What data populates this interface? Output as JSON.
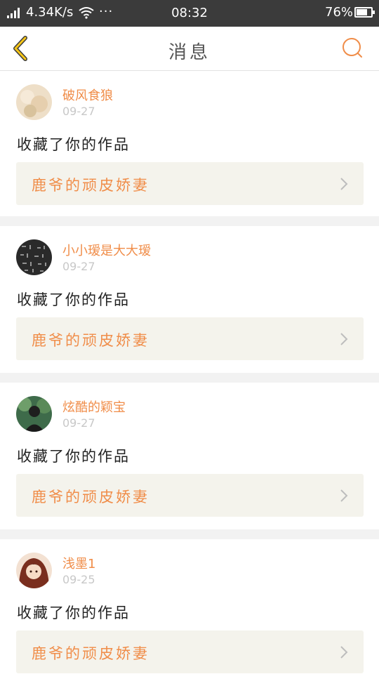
{
  "status_bar": {
    "network_speed": "4.34K/s",
    "more": "···",
    "time": "08:32",
    "battery_percent": "76%",
    "battery_level": 0.76
  },
  "navbar": {
    "title": "消息",
    "back_icon": "chevron-left-icon",
    "search_icon": "search-icon"
  },
  "colors": {
    "accent": "#f08d49",
    "back_arrow": "#f5c518",
    "status_bar_bg": "#3b3b3b",
    "card_work_bg": "#f4f3ec"
  },
  "notifications": [
    {
      "username": "破风食狼",
      "date": "09-27",
      "action": "收藏了你的作品",
      "work_title": "鹿爷的顽皮娇妻"
    },
    {
      "username": "小小瑷是大大瑷",
      "date": "09-27",
      "action": "收藏了你的作品",
      "work_title": "鹿爷的顽皮娇妻"
    },
    {
      "username": "炫酷的颖宝",
      "date": "09-27",
      "action": "收藏了你的作品",
      "work_title": "鹿爷的顽皮娇妻"
    },
    {
      "username": "浅墨1",
      "date": "09-25",
      "action": "收藏了你的作品",
      "work_title": "鹿爷的顽皮娇妻"
    }
  ]
}
